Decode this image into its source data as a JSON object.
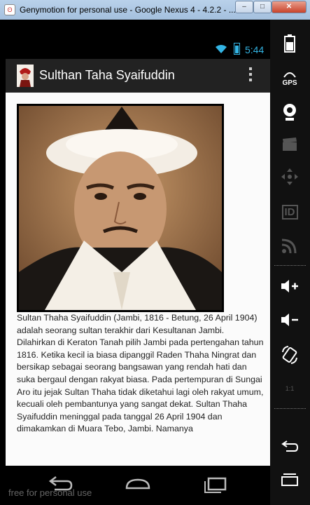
{
  "window": {
    "title": "Genymotion for personal use - Google Nexus 4 - 4.2.2 - ...",
    "minimize_label": "–",
    "maximize_label": "□",
    "close_label": "✕"
  },
  "status_bar": {
    "time": "5:44"
  },
  "action_bar": {
    "title": "Sulthan Taha Syaifuddin"
  },
  "article": {
    "text": "Sultan Thaha Syaifuddin (Jambi, 1816 - Betung, 26 April 1904) adalah seorang sultan terakhir dari Kesultanan Jambi. Dilahirkan di Keraton Tanah pilih Jambi pada pertengahan tahun 1816. Ketika kecil ia biasa dipanggil Raden Thaha Ningrat dan bersikap sebagai seorang bangsawan yang rendah hati dan suka bergaul dengan rakyat biasa. Pada pertempuran di Sungai Aro itu jejak Sultan Thaha tidak diketahui lagi oleh rakyat umum, kecuali oleh pembantunya yang sangat dekat. Sultan Thaha Syaifuddin meninggal pada tanggal 26 April 1904 dan dimakamkan di Muara Tebo, Jambi.  Namanya"
  },
  "watermark": "free for personal use",
  "sidebar": {
    "gps_label": "GPS",
    "id_label": "ID",
    "ratio_label": "1:1"
  },
  "colors": {
    "status_accent": "#33b5e5",
    "action_bar": "#222222",
    "content_bg": "#fbfbfb"
  }
}
